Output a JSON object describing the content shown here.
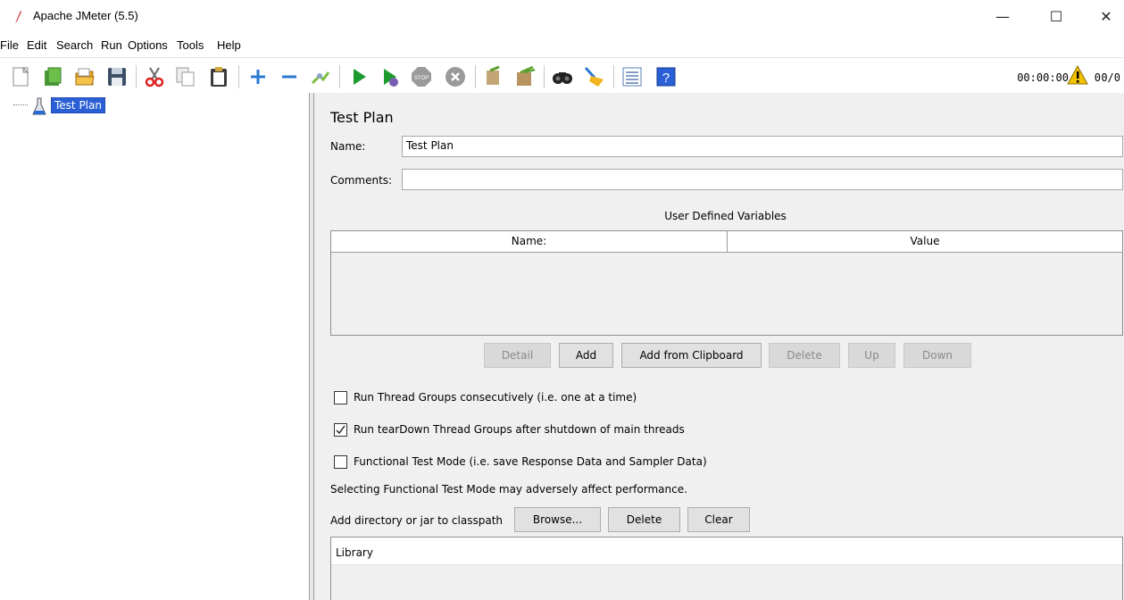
{
  "window": {
    "title": "Apache JMeter (5.5)",
    "minimize": "—",
    "maximize": "☐",
    "close": "✕"
  },
  "menu": [
    "File",
    "Edit",
    "Search",
    "Run",
    "Options",
    "Tools",
    "Help"
  ],
  "toolbar": {
    "icons": [
      "new-icon",
      "templates-icon",
      "open-icon",
      "save-icon",
      "cut-icon",
      "copy-icon",
      "paste-icon",
      "expand-icon",
      "collapse-icon",
      "toggle-icon",
      "start-icon",
      "start-no-pauses-icon",
      "stop-icon",
      "shutdown-icon",
      "clear-icon",
      "clear-all-icon",
      "search-icon",
      "reset-search-icon",
      "function-helper-icon",
      "help-icon"
    ],
    "timer": "00:00:00",
    "warning_count": "0",
    "threads": "0/0"
  },
  "tree": {
    "root_label": "Test Plan"
  },
  "test_plan": {
    "heading": "Test Plan",
    "name_label": "Name:",
    "name_value": "Test Plan",
    "comments_label": "Comments:",
    "comments_value": "",
    "udv_title": "User Defined Variables",
    "columns": [
      "Name:",
      "Value"
    ],
    "buttons": {
      "detail": "Detail",
      "add": "Add",
      "add_clipboard": "Add from Clipboard",
      "delete": "Delete",
      "up": "Up",
      "down": "Down"
    },
    "checkboxes": [
      {
        "label": "Run Thread Groups consecutively (i.e. one at a time)",
        "checked": false
      },
      {
        "label": "Run tearDown Thread Groups after shutdown of main threads",
        "checked": true
      },
      {
        "label": "Functional Test Mode (i.e. save Response Data and Sampler Data)",
        "checked": false
      }
    ],
    "functional_note": "Selecting Functional Test Mode may adversely affect performance.",
    "classpath_label": "Add directory or jar to classpath",
    "classpath_buttons": {
      "browse": "Browse...",
      "delete": "Delete",
      "clear": "Clear"
    },
    "library_header": "Library"
  },
  "colors": {
    "selection": "#2a5fd6",
    "panel": "#f0f0f0",
    "start_green": "#1e9b2e",
    "warning": "#f2c200"
  }
}
